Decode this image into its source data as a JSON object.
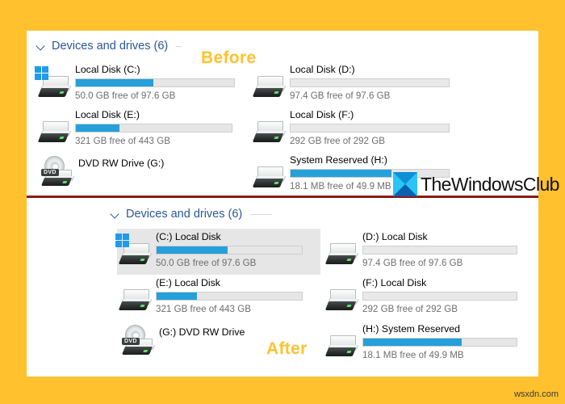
{
  "page": {
    "background_color": "#FFC12E",
    "panel_color": "#FFFFFF",
    "divider_color": "#8B1A12",
    "accent_bar_color": "#26A0DA",
    "bar_track_color": "#E6E6E6",
    "header_color": "#2B5797",
    "caption_color": "#FFC42E",
    "site_watermark": "wsxdn.com"
  },
  "watermark": {
    "brand": "TheWindowsClub",
    "logo_name": "thewindowsclub-logo"
  },
  "before": {
    "caption": "Before",
    "group_header": "Devices and drives (6)",
    "drives": [
      {
        "name": "Local Disk (C:)",
        "capacity_text": "50.0 GB free of 97.6 GB",
        "icon": "hard-drive-windows-icon",
        "used_percent": 49,
        "has_bar": true,
        "selected": false
      },
      {
        "name": "Local Disk (D:)",
        "capacity_text": "97.4 GB free of 97.6 GB",
        "icon": "hard-drive-icon",
        "used_percent": 0,
        "has_bar": true,
        "selected": false
      },
      {
        "name": "Local Disk (E:)",
        "capacity_text": "321 GB free of 443 GB",
        "icon": "hard-drive-icon",
        "used_percent": 28,
        "has_bar": true,
        "selected": false
      },
      {
        "name": "Local Disk (F:)",
        "capacity_text": "292 GB free of 292 GB",
        "icon": "hard-drive-icon",
        "used_percent": 0,
        "has_bar": true,
        "selected": false
      },
      {
        "name": "DVD RW Drive (G:)",
        "capacity_text": "",
        "icon": "dvd-drive-icon",
        "used_percent": 0,
        "has_bar": false,
        "selected": false
      },
      {
        "name": "System Reserved (H:)",
        "capacity_text": "18.1 MB free of 49.9 MB",
        "icon": "hard-drive-icon",
        "used_percent": 64,
        "has_bar": true,
        "selected": false
      }
    ]
  },
  "after": {
    "caption": "After",
    "group_header": "Devices and drives (6)",
    "drives": [
      {
        "name": "(C:) Local Disk",
        "capacity_text": "50.0 GB free of 97.6 GB",
        "icon": "hard-drive-windows-icon",
        "used_percent": 49,
        "has_bar": true,
        "selected": true
      },
      {
        "name": "(D:) Local Disk",
        "capacity_text": "97.4 GB free of 97.6 GB",
        "icon": "hard-drive-icon",
        "used_percent": 0,
        "has_bar": true,
        "selected": false
      },
      {
        "name": "(E:) Local Disk",
        "capacity_text": "321 GB free of 443 GB",
        "icon": "hard-drive-icon",
        "used_percent": 28,
        "has_bar": true,
        "selected": false
      },
      {
        "name": "(F:) Local Disk",
        "capacity_text": "292 GB free of 292 GB",
        "icon": "hard-drive-icon",
        "used_percent": 0,
        "has_bar": true,
        "selected": false
      },
      {
        "name": "(G:) DVD RW Drive",
        "capacity_text": "",
        "icon": "dvd-drive-icon",
        "used_percent": 0,
        "has_bar": false,
        "selected": false
      },
      {
        "name": "(H:) System Reserved",
        "capacity_text": "18.1 MB free of 49.9 MB",
        "icon": "hard-drive-icon",
        "used_percent": 64,
        "has_bar": true,
        "selected": false
      }
    ]
  }
}
